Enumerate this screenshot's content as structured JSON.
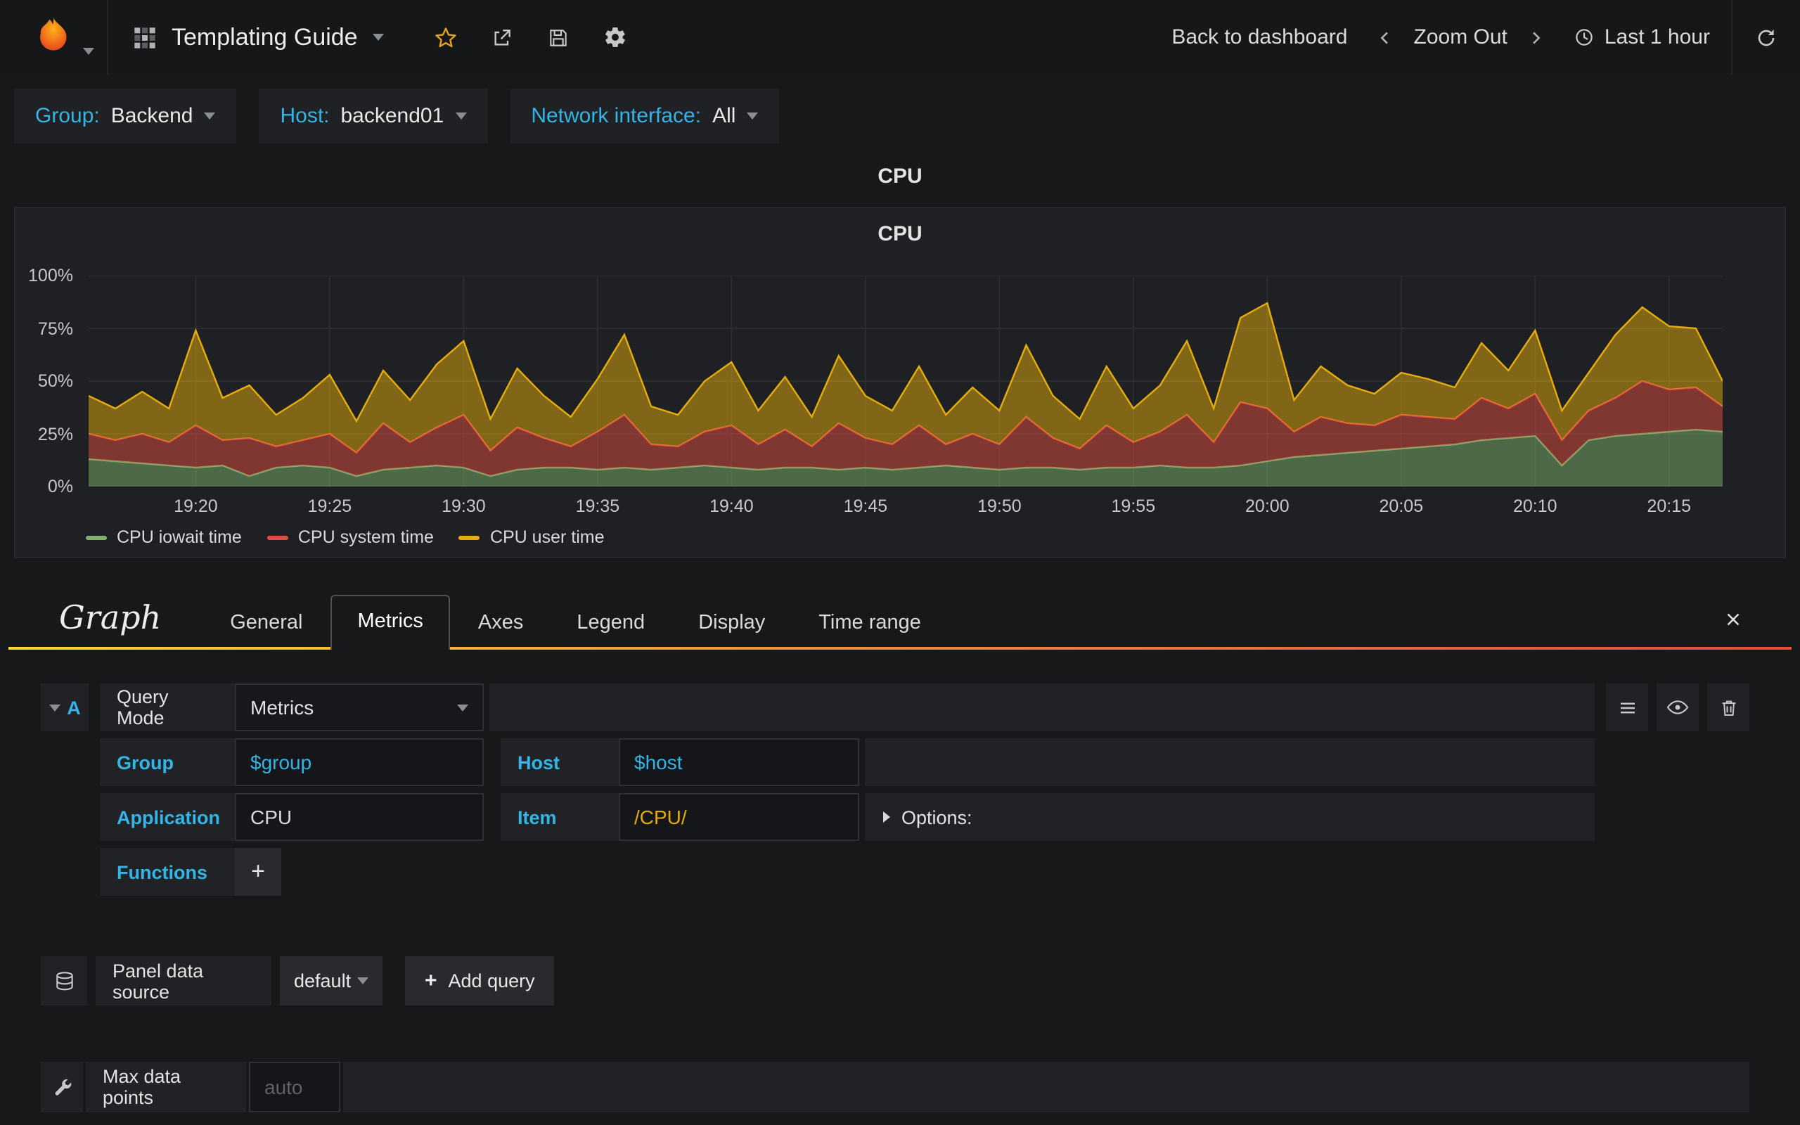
{
  "colors": {
    "accent_cyan": "#33b5e5",
    "accent_orange": "#eb7b18",
    "background": "#171819",
    "panel_bg": "#1f2023",
    "cell_bg": "#202226",
    "input_bg": "#141619"
  },
  "navbar": {
    "dashboard_title": "Templating Guide",
    "back_to_dashboard": "Back to dashboard",
    "zoom_out": "Zoom Out",
    "time_range": "Last 1 hour"
  },
  "icons": [
    "grafana-logo",
    "dashboard-grid-icon",
    "caret-down-icon",
    "star-icon",
    "share-icon",
    "save-icon",
    "settings-gear-icon",
    "chevron-left-icon",
    "chevron-right-icon",
    "clock-icon",
    "refresh-icon",
    "menu-icon",
    "eye-icon",
    "trash-icon",
    "database-icon",
    "wrench-icon",
    "plus-icon",
    "close-icon",
    "options-caret-icon"
  ],
  "variables": [
    {
      "label": "Group:",
      "value": "Backend"
    },
    {
      "label": "Host:",
      "value": "backend01"
    },
    {
      "label": "Network interface:",
      "value": "All"
    }
  ],
  "panel": {
    "title": "CPU",
    "graph_title": "CPU"
  },
  "chart_data": {
    "type": "area",
    "stacked": true,
    "title": "CPU",
    "ylim": [
      0,
      100
    ],
    "grid": true,
    "legend_position": "bottom-left",
    "y_ticks": [
      {
        "value": 0,
        "label": "0%"
      },
      {
        "value": 25,
        "label": "25%"
      },
      {
        "value": 50,
        "label": "50%"
      },
      {
        "value": 75,
        "label": "75%"
      },
      {
        "value": 100,
        "label": "100%"
      }
    ],
    "x_start": "19:16",
    "x_end": "20:17",
    "x_interval_minutes": 1,
    "x_tick_labels": [
      "19:20",
      "19:25",
      "19:30",
      "19:35",
      "19:40",
      "19:45",
      "19:50",
      "19:55",
      "20:00",
      "20:05",
      "20:10",
      "20:15"
    ],
    "x_tick_indices": [
      4,
      9,
      14,
      19,
      24,
      29,
      34,
      39,
      44,
      49,
      54,
      59
    ],
    "series": [
      {
        "name": "CPU iowait time",
        "color": "#7EB26D",
        "values": [
          13,
          12,
          11,
          10,
          9,
          10,
          5,
          9,
          10,
          9,
          5,
          8,
          9,
          10,
          9,
          5,
          8,
          9,
          9,
          8,
          9,
          8,
          9,
          10,
          9,
          8,
          9,
          9,
          8,
          9,
          8,
          9,
          10,
          9,
          8,
          9,
          9,
          8,
          9,
          9,
          10,
          9,
          9,
          10,
          12,
          14,
          15,
          16,
          17,
          18,
          19,
          20,
          22,
          23,
          24,
          10,
          22,
          24,
          25,
          26,
          27,
          26
        ]
      },
      {
        "name": "CPU system time",
        "color": "#E24D42",
        "values": [
          12,
          10,
          14,
          11,
          20,
          12,
          18,
          10,
          12,
          16,
          11,
          22,
          12,
          18,
          25,
          12,
          20,
          14,
          10,
          18,
          25,
          12,
          10,
          16,
          20,
          12,
          18,
          10,
          22,
          14,
          12,
          20,
          10,
          16,
          12,
          24,
          14,
          10,
          20,
          12,
          16,
          25,
          12,
          30,
          25,
          12,
          18,
          14,
          12,
          16,
          14,
          12,
          20,
          14,
          20,
          12,
          14,
          18,
          25,
          20,
          20,
          12
        ]
      },
      {
        "name": "CPU user time",
        "color": "#E5AC0E",
        "values": [
          18,
          15,
          20,
          16,
          45,
          20,
          25,
          15,
          20,
          28,
          15,
          25,
          20,
          30,
          35,
          15,
          28,
          20,
          14,
          25,
          38,
          18,
          15,
          24,
          30,
          16,
          25,
          14,
          32,
          20,
          16,
          28,
          14,
          22,
          16,
          34,
          20,
          14,
          28,
          16,
          22,
          35,
          16,
          40,
          50,
          15,
          24,
          18,
          15,
          20,
          18,
          15,
          26,
          18,
          30,
          14,
          18,
          30,
          35,
          30,
          28,
          12
        ]
      }
    ]
  },
  "editor": {
    "panel_type": "Graph",
    "tabs": [
      "General",
      "Metrics",
      "Axes",
      "Legend",
      "Display",
      "Time range"
    ],
    "active_tab": "Metrics",
    "query": {
      "letter": "A",
      "query_mode_label": "Query Mode",
      "query_mode_value": "Metrics",
      "group_label": "Group",
      "group_value": "$group",
      "host_label": "Host",
      "host_value": "$host",
      "application_label": "Application",
      "application_value": "CPU",
      "item_label": "Item",
      "item_value": "/CPU/",
      "options_label": "Options:",
      "functions_label": "Functions",
      "add_function_label": "+"
    },
    "datasource": {
      "label": "Panel data source",
      "value": "default",
      "add_query_label": "Add query"
    },
    "footer": {
      "max_data_points_label": "Max data points",
      "max_data_points_placeholder": "auto"
    }
  }
}
